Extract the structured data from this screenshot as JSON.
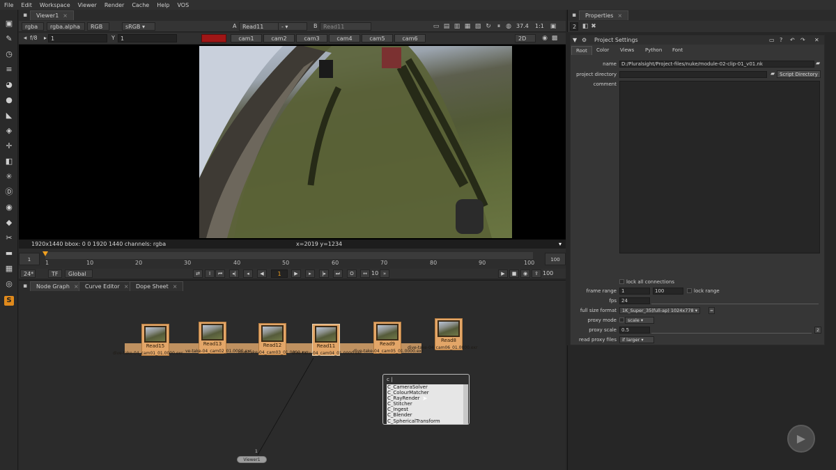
{
  "menu": [
    "File",
    "Edit",
    "Workspace",
    "Viewer",
    "Render",
    "Cache",
    "Help",
    "VOS"
  ],
  "viewer": {
    "tab_label": "Viewer1",
    "tab_close": "×",
    "channels": "rgba",
    "alpha_channel": "rgba.alpha",
    "display": "RGB",
    "lut": "sRGB",
    "input_a_label": "A",
    "input_a": "Read11",
    "wipe_mode": "-",
    "input_b_label": "B",
    "input_b": "Read11",
    "zoom": "37.4",
    "downscale": "1:1",
    "fstop": "f/8",
    "gain": "1",
    "gamma_label": "Y",
    "gamma": "1",
    "cam_buttons": [
      "cam1",
      "cam2",
      "cam3",
      "cam4",
      "cam5",
      "cam6"
    ],
    "view_mode": "2D",
    "info_format": "1920x1440  bbox: 0 0 1920 1440 channels: rgba",
    "info_coords": "x=2019 y=1234"
  },
  "timeline": {
    "start": "1",
    "end": "100",
    "ticks": [
      "1",
      "10",
      "20",
      "30",
      "40",
      "50",
      "60",
      "70",
      "80",
      "90",
      "100"
    ],
    "fps": "24*",
    "tf": "TF",
    "range_mode": "Global",
    "current_frame": "1",
    "step": "10",
    "end_frame": "100",
    "playhead_fraction": 0
  },
  "nodegraph": {
    "tabs": [
      "Node Graph",
      "Curve Editor",
      "Dope Sheet"
    ],
    "nodes": [
      {
        "label": "Read15",
        "file": "dive-take-04_cam01_01.0000.exr"
      },
      {
        "label": "Read13",
        "file": "ve-take-04_cam02_01.0000.exr"
      },
      {
        "label": "Read12",
        "file": "dive-take-04_cam03_01.0000.exr"
      },
      {
        "label": "Read11",
        "file": "dive-take-04_cam04_01.0000.exr"
      },
      {
        "label": "Read9",
        "file": "dive-take-04_cam05_01.0000.exr"
      },
      {
        "label": "Read8",
        "file": "dive-take-04_cam06_01.0000.exr"
      }
    ],
    "viewer_node": "Viewer1",
    "viewer_input": "1",
    "tab_menu": {
      "query": "c",
      "items": [
        "C_CameraSolver",
        "C_ColourMatcher",
        "C_RayRender",
        "C_Stitcher",
        "C_Ingest",
        "C_Blender",
        "C_SphericalTransform"
      ]
    }
  },
  "properties": {
    "tab_label": "Properties",
    "panel_count": "2",
    "panel_title": "Project Settings",
    "tabs": [
      "Root",
      "Color",
      "Views",
      "Python",
      "Font"
    ],
    "name_label": "name",
    "name_value": "D:/Pluralsight/Project-files/nuke/module-02-clip-01_v01.nk",
    "project_directory_label": "project directory",
    "project_directory_value": "",
    "script_directory_button": "Script Directory",
    "comment_label": "comment",
    "lock_connections_label": "lock all connections",
    "frame_range_label": "frame range",
    "frame_range_start": "1",
    "frame_range_end": "100",
    "lock_range_label": "lock range",
    "fps_label": "fps",
    "fps_value": "24",
    "full_size_format_label": "full size format",
    "full_size_format_value": "1K_Super_35(full-ap) 1024x778",
    "proxy_mode_label": "proxy mode",
    "proxy_mode_value": "scale",
    "proxy_scale_label": "proxy scale",
    "proxy_scale_value": "0.5",
    "proxy_scale_button": "2",
    "read_proxy_files_label": "read proxy files",
    "read_proxy_files_value": "if larger"
  }
}
